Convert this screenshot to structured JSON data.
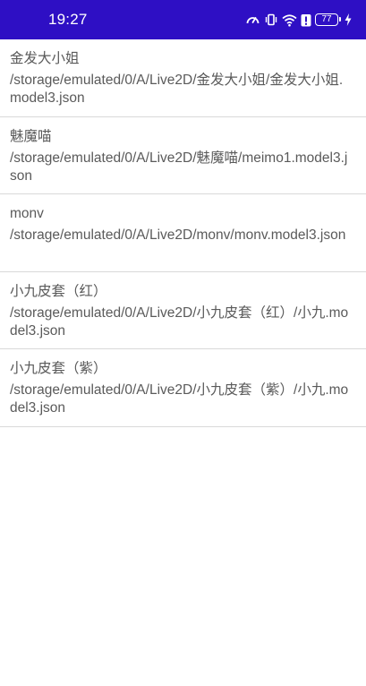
{
  "status_bar": {
    "time": "19:27",
    "battery_level": "77",
    "icons": [
      "speedometer-icon",
      "vibrate-icon",
      "wifi-icon",
      "battery-alert-icon",
      "battery-icon",
      "charging-icon"
    ],
    "background_color": "#2e0fc4"
  },
  "files": [
    {
      "name": "金发大小姐",
      "path": "/storage/emulated/0/A/Live2D/金发大小姐/金发大小姐.model3.json"
    },
    {
      "name": "魅魔喵",
      "path": "/storage/emulated/0/A/Live2D/魅魔喵/meimo1.model3.json"
    },
    {
      "name": "monv",
      "path": "/storage/emulated/0/A/Live2D/monv/monv.model3.json"
    },
    {
      "name": "小九皮套（红）",
      "path": "/storage/emulated/0/A/Live2D/小九皮套（红）/小九.model3.json"
    },
    {
      "name": "小九皮套（紫）",
      "path": "/storage/emulated/0/A/Live2D/小九皮套（紫）/小九.model3.json"
    }
  ]
}
